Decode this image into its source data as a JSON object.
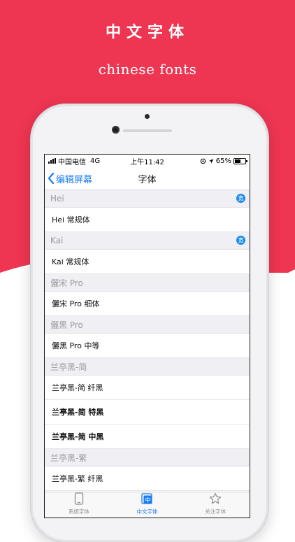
{
  "promo": {
    "title": "中文字体",
    "subtitle": "chinese fonts"
  },
  "colors": {
    "brand": "#ee3552",
    "accent": "#1a7cf2"
  },
  "status_bar": {
    "carrier": "中国电信",
    "network": "4G",
    "time": "上午11:42",
    "battery": "65%",
    "battery_level": 0.65
  },
  "nav": {
    "back_label": "编辑屏幕",
    "title": "字体"
  },
  "sections": [
    {
      "header": "Hei",
      "badge": "宽",
      "rows": [
        {
          "label": "Hei 常规体",
          "bold": false
        }
      ]
    },
    {
      "header": "Kai",
      "badge": "宽",
      "rows": [
        {
          "label": "Kai 常规体",
          "bold": false
        }
      ]
    },
    {
      "header": "儷宋 Pro",
      "badge": "",
      "rows": [
        {
          "label": "儷宋 Pro 细体",
          "bold": false
        }
      ]
    },
    {
      "header": "儷黑 Pro",
      "badge": "",
      "rows": [
        {
          "label": "儷黑 Pro 中等",
          "bold": false
        }
      ]
    },
    {
      "header": "兰亭黑-简",
      "badge": "",
      "rows": [
        {
          "label": "兰亭黑-简 纤黑",
          "bold": false
        },
        {
          "label": "兰亭黑-简 特黑",
          "bold": true
        },
        {
          "label": "兰亭黑-简 中黑",
          "bold": true
        }
      ]
    },
    {
      "header": "兰亭黑-繁",
      "badge": "",
      "rows": [
        {
          "label": "兰亭黑-繁 纤黑",
          "bold": false
        }
      ]
    }
  ],
  "tabs": [
    {
      "label": "系统字体",
      "icon": "phone-icon",
      "active": false
    },
    {
      "label": "中文字体",
      "icon": "chinese-font-icon",
      "active": true
    },
    {
      "label": "关注字体",
      "icon": "star-icon",
      "active": false
    }
  ]
}
